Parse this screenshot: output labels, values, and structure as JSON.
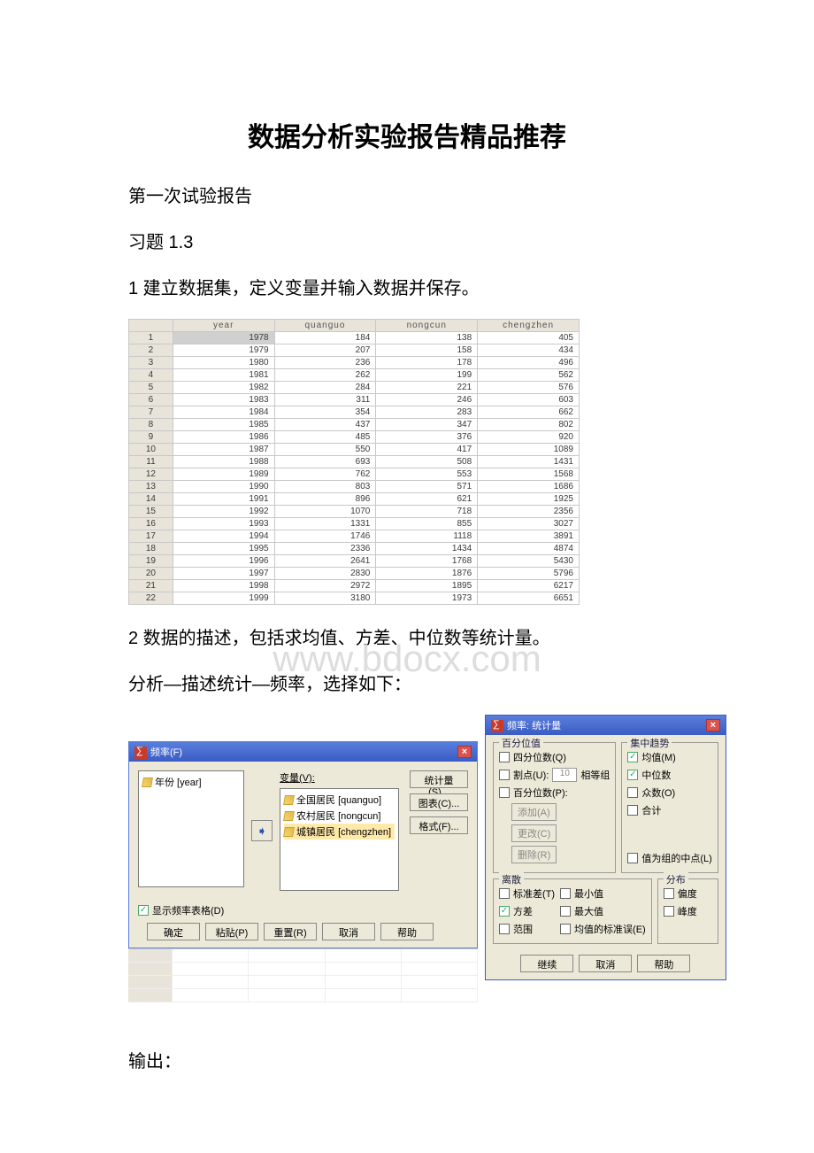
{
  "title": "数据分析实验报告精品推荐",
  "p1": "第一次试验报告",
  "p2": "习题 1.3",
  "p3": "1 建立数据集，定义变量并输入数据并保存。",
  "p4": "2 数据的描述，包括求均值、方差、中位数等统计量。",
  "p5": "分析—描述统计—频率，选择如下：",
  "output_label": "输出：",
  "watermark": "www.bdocx.com",
  "chart_data": {
    "type": "table",
    "columns": [
      "",
      "year",
      "quanguo",
      "nongcun",
      "chengzhen"
    ],
    "rows": [
      [
        "1",
        "1978",
        "184",
        "138",
        "405"
      ],
      [
        "2",
        "1979",
        "207",
        "158",
        "434"
      ],
      [
        "3",
        "1980",
        "236",
        "178",
        "496"
      ],
      [
        "4",
        "1981",
        "262",
        "199",
        "562"
      ],
      [
        "5",
        "1982",
        "284",
        "221",
        "576"
      ],
      [
        "6",
        "1983",
        "311",
        "246",
        "603"
      ],
      [
        "7",
        "1984",
        "354",
        "283",
        "662"
      ],
      [
        "8",
        "1985",
        "437",
        "347",
        "802"
      ],
      [
        "9",
        "1986",
        "485",
        "376",
        "920"
      ],
      [
        "10",
        "1987",
        "550",
        "417",
        "1089"
      ],
      [
        "11",
        "1988",
        "693",
        "508",
        "1431"
      ],
      [
        "12",
        "1989",
        "762",
        "553",
        "1568"
      ],
      [
        "13",
        "1990",
        "803",
        "571",
        "1686"
      ],
      [
        "14",
        "1991",
        "896",
        "621",
        "1925"
      ],
      [
        "15",
        "1992",
        "1070",
        "718",
        "2356"
      ],
      [
        "16",
        "1993",
        "1331",
        "855",
        "3027"
      ],
      [
        "17",
        "1994",
        "1746",
        "1118",
        "3891"
      ],
      [
        "18",
        "1995",
        "2336",
        "1434",
        "4874"
      ],
      [
        "19",
        "1996",
        "2641",
        "1768",
        "5430"
      ],
      [
        "20",
        "1997",
        "2830",
        "1876",
        "5796"
      ],
      [
        "21",
        "1998",
        "2972",
        "1895",
        "6217"
      ],
      [
        "22",
        "1999",
        "3180",
        "1973",
        "6651"
      ]
    ]
  },
  "freq_dialog": {
    "title": "频率(F)",
    "var_label": "变量(V):",
    "left_items": [
      {
        "text": "年份 [year]"
      }
    ],
    "right_items": [
      {
        "text": "全国居民 [quanguo]"
      },
      {
        "text": "农村居民 [nongcun]"
      },
      {
        "text": "城镇居民 [chengzhen]"
      }
    ],
    "side_buttons": {
      "stat": "统计量(S)...",
      "chart": "图表(C)...",
      "format": "格式(F)..."
    },
    "show_table": "显示频率表格(D)",
    "buttons": {
      "ok": "确定",
      "paste": "粘贴(P)",
      "reset": "重置(R)",
      "cancel": "取消",
      "help": "帮助"
    }
  },
  "stats_dialog": {
    "title": "频率: 统计量",
    "percentile": {
      "legend": "百分位值",
      "quartiles": "四分位数(Q)",
      "cutpoints": "割点(U):",
      "cut_val": "10",
      "equal_groups": "相等组",
      "percentiles": "百分位数(P):",
      "add": "添加(A)",
      "change": "更改(C)",
      "remove": "删除(R)"
    },
    "central": {
      "legend": "集中趋势",
      "mean": "均值(M)",
      "median": "中位数",
      "mode": "众数(O)",
      "sum": "合计"
    },
    "midpoint": "值为组的中点(L)",
    "dispersion": {
      "legend": "离散",
      "std": "标准差(T)",
      "min": "最小值",
      "var": "方差",
      "max": "最大值",
      "range": "范围",
      "se": "均值的标准误(E)"
    },
    "dist": {
      "legend": "分布",
      "skew": "偏度",
      "kurt": "峰度"
    },
    "buttons": {
      "continue": "继续",
      "cancel": "取消",
      "help": "帮助"
    }
  }
}
